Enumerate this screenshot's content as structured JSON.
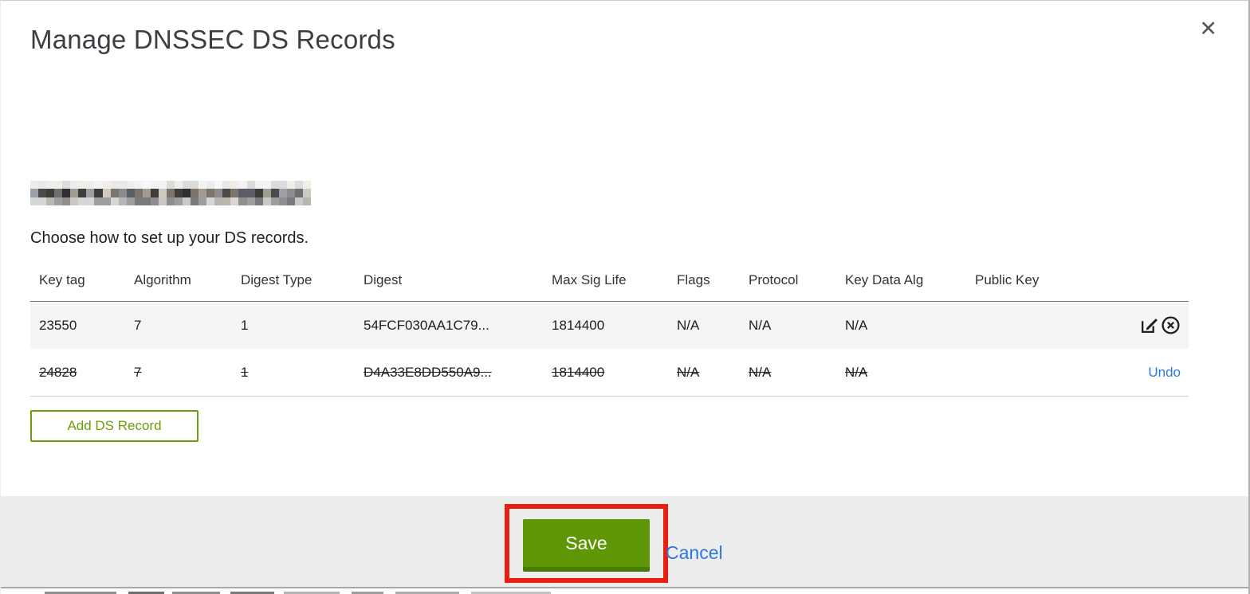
{
  "modal": {
    "title": "Manage DNSSEC DS Records",
    "close_label": "✕",
    "instruction": "Choose how to set up your DS records.",
    "table": {
      "headers": [
        "Key tag",
        "Algorithm",
        "Digest Type",
        "Digest",
        "Max Sig Life",
        "Flags",
        "Protocol",
        "Key Data Alg",
        "Public Key"
      ],
      "rows": [
        {
          "cells": [
            "23550",
            "7",
            "1",
            "54FCF030AA1C79...",
            "1814400",
            "N/A",
            "N/A",
            "N/A",
            ""
          ],
          "state": "normal",
          "actions": [
            "edit",
            "delete"
          ]
        },
        {
          "cells": [
            "24828",
            "7",
            "1",
            "D4A33E8DD550A9...",
            "1814400",
            "N/A",
            "N/A",
            "N/A",
            ""
          ],
          "state": "deleted",
          "action_label": "Undo"
        }
      ]
    },
    "add_button_label": "Add DS Record",
    "footer": {
      "save_label": "Save",
      "cancel_label": "Cancel"
    },
    "colors": {
      "button_green": "#5e9605",
      "button_green_shadow": "#4b7a04",
      "outline_green": "#6a9e0c",
      "link_blue": "#2b7ae0",
      "annotation_red": "#e7200f",
      "footer_gray": "#ededed",
      "row_stripe_gray": "#f5f5f5"
    }
  }
}
